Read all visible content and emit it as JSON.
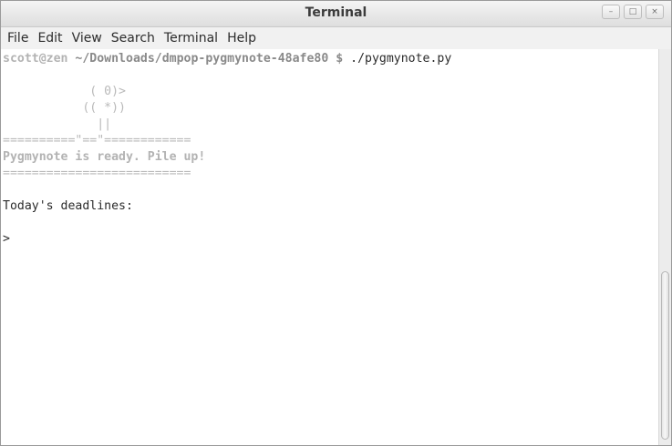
{
  "window": {
    "title": "Terminal",
    "buttons": {
      "minimize": "–",
      "maximize": "□",
      "close": "×"
    }
  },
  "menu": [
    "File",
    "Edit",
    "View",
    "Search",
    "Terminal",
    "Help"
  ],
  "terminal": {
    "prompt_user": "scott@zen",
    "prompt_path": "~/Downloads/dmpop-pygmynote-48afe80 $",
    "command": " ./pygmynote.py",
    "art": [
      "            ( 0)>",
      "           (( *))",
      "             ||"
    ],
    "rule_top": "==========\"==\"============",
    "ready_msg": "Pygmynote is ready. Pile up!",
    "rule_bottom": "==========================",
    "deadlines": "Today's deadlines:",
    "input_prompt": ">"
  }
}
